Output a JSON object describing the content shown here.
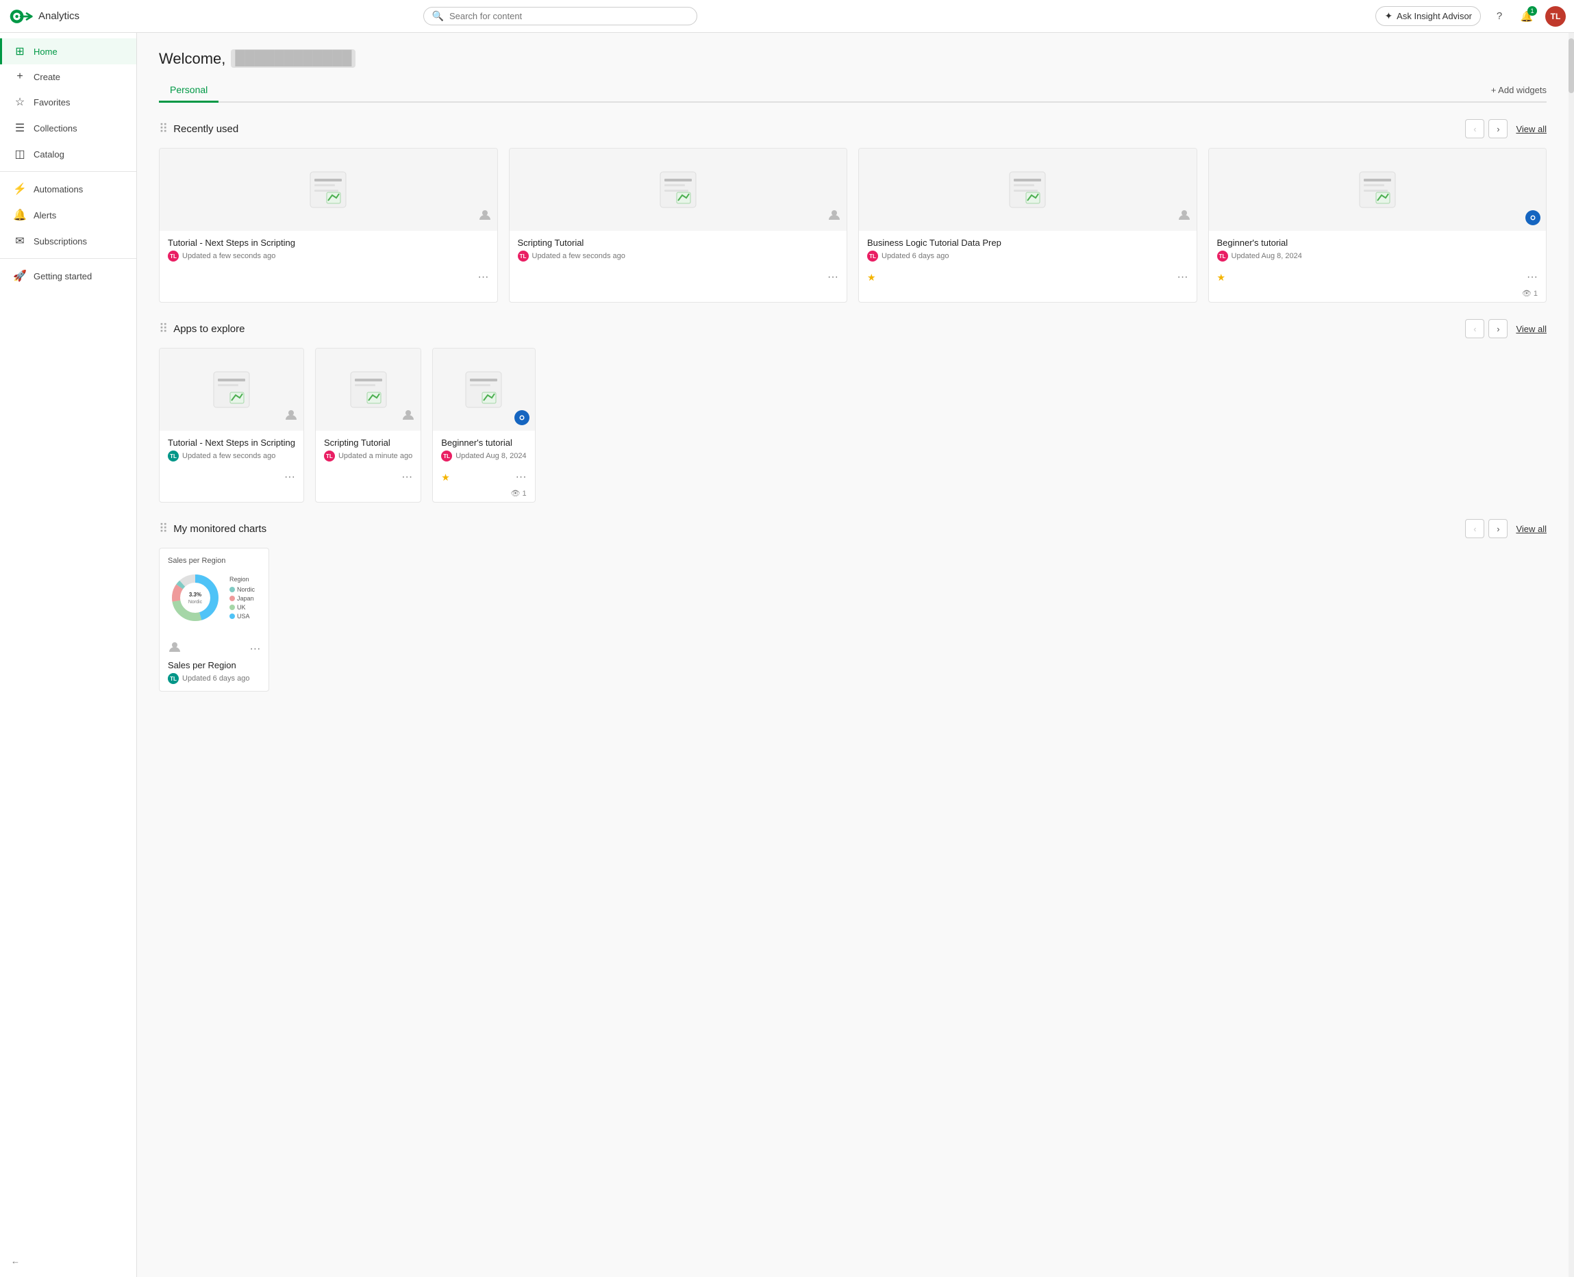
{
  "topbar": {
    "app_name": "Analytics",
    "search_placeholder": "Search for content",
    "insight_btn_label": "Ask Insight Advisor",
    "help_icon": "?",
    "notif_count": "1",
    "avatar_initials": "TL"
  },
  "sidebar": {
    "items": [
      {
        "id": "home",
        "label": "Home",
        "icon": "⊞",
        "active": true
      },
      {
        "id": "create",
        "label": "Create",
        "icon": "+",
        "active": false
      },
      {
        "id": "favorites",
        "label": "Favorites",
        "icon": "☆",
        "active": false
      },
      {
        "id": "collections",
        "label": "Collections",
        "icon": "☰",
        "active": false
      },
      {
        "id": "catalog",
        "label": "Catalog",
        "icon": "◫",
        "active": false
      },
      {
        "id": "automations",
        "label": "Automations",
        "icon": "⚡",
        "active": false
      },
      {
        "id": "alerts",
        "label": "Alerts",
        "icon": "□",
        "active": false
      },
      {
        "id": "subscriptions",
        "label": "Subscriptions",
        "icon": "✉",
        "active": false
      },
      {
        "id": "getting-started",
        "label": "Getting started",
        "icon": "🚀",
        "active": false
      }
    ],
    "collapse_label": "←"
  },
  "page": {
    "welcome_text": "Welcome,",
    "welcome_name": "████████████",
    "tabs": [
      {
        "id": "personal",
        "label": "Personal",
        "active": true
      }
    ],
    "add_widgets_label": "+ Add widgets"
  },
  "recently_used": {
    "section_title": "Recently used",
    "view_all_label": "View all",
    "cards": [
      {
        "title": "Tutorial - Next Steps in Scripting",
        "updated": "Updated a few seconds ago",
        "avatar_initials": "TL",
        "avatar_color": "pink",
        "starred": false,
        "badge": "person"
      },
      {
        "title": "Scripting Tutorial",
        "updated": "Updated a few seconds ago",
        "avatar_initials": "TL",
        "avatar_color": "pink",
        "starred": false,
        "badge": "person"
      },
      {
        "title": "Business Logic Tutorial Data Prep",
        "updated": "Updated 6 days ago",
        "avatar_initials": "TL",
        "avatar_color": "pink",
        "starred": true,
        "badge": "person"
      },
      {
        "title": "Beginner's tutorial",
        "updated": "Updated Aug 8, 2024",
        "avatar_initials": "TL",
        "avatar_color": "pink",
        "starred": true,
        "badge": "blue-circle",
        "views": "1"
      }
    ]
  },
  "apps_to_explore": {
    "section_title": "Apps to explore",
    "view_all_label": "View all",
    "cards": [
      {
        "title": "Tutorial - Next Steps in Scripting",
        "updated": "Updated a few seconds ago",
        "avatar_initials": "TL",
        "avatar_color": "teal",
        "starred": false,
        "badge": "person"
      },
      {
        "title": "Scripting Tutorial",
        "updated": "Updated a minute ago",
        "avatar_initials": "TL",
        "avatar_color": "pink",
        "starred": false,
        "badge": "person"
      },
      {
        "title": "Beginner's tutorial",
        "updated": "Updated Aug 8, 2024",
        "avatar_initials": "TL",
        "avatar_color": "pink",
        "starred": true,
        "badge": "blue-circle",
        "views": "1"
      }
    ]
  },
  "my_monitored_charts": {
    "section_title": "My monitored charts",
    "view_all_label": "View all",
    "charts": [
      {
        "title": "Sales per Region",
        "updated": "Updated 6 days ago",
        "avatar_initials": "TL",
        "avatar_color": "teal",
        "chart_header": "Sales per Region",
        "legend": [
          {
            "label": "USA",
            "color": "#4fc3f7",
            "value": "45.9%"
          },
          {
            "label": "Nordic",
            "color": "#80cbc4",
            "value": "3.3%"
          },
          {
            "label": "Japan",
            "color": "#ef9a9a",
            "value": "12.3%"
          },
          {
            "label": "UK",
            "color": "#a5d6a7",
            "value": "26.9%"
          }
        ]
      }
    ]
  }
}
